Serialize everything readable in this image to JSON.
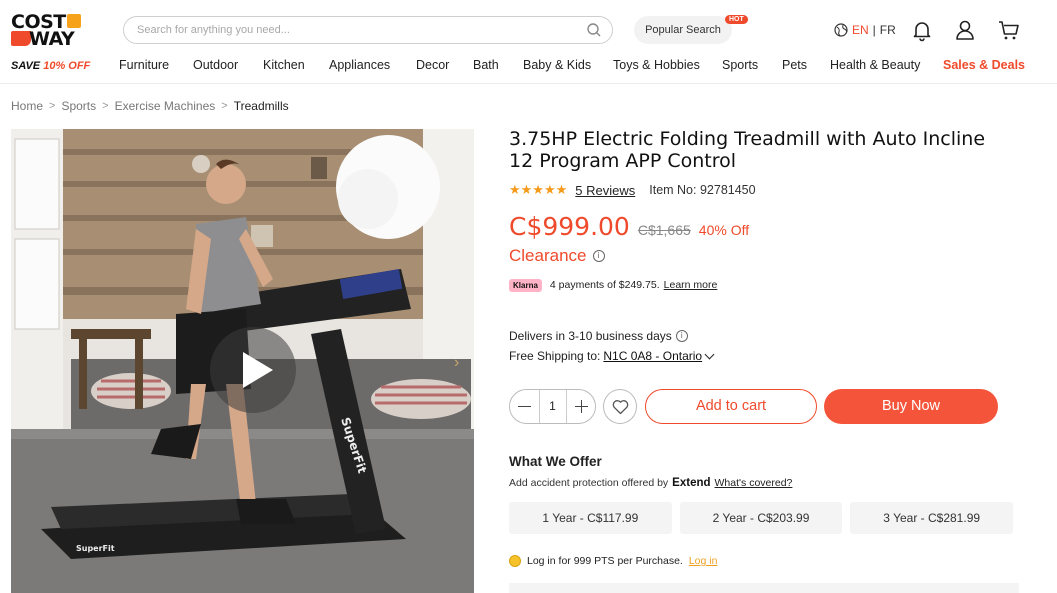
{
  "brand": {
    "logo_line1": "COST",
    "logo_line2": "WAY",
    "save_prefix": "SAVE",
    "save_pct": "10% OFF",
    "accent_color": "#ef4a2b",
    "logo_box_color": "#f7a21b"
  },
  "header": {
    "search_placeholder": "Search for anything you need...",
    "popular_search": "Popular Search",
    "hot_badge": "HOT",
    "lang_en": "EN",
    "lang_sep": "|",
    "lang_fr": "FR",
    "icons": [
      "search-icon",
      "globe-icon",
      "bell-icon",
      "user-icon",
      "cart-icon"
    ]
  },
  "nav": [
    "Furniture",
    "Outdoor",
    "Kitchen",
    "Appliances",
    "Decor",
    "Bath",
    "Baby & Kids",
    "Toys & Hobbies",
    "Sports",
    "Pets",
    "Health & Beauty",
    "Sales & Deals"
  ],
  "breadcrumb": {
    "items": [
      "Home",
      "Sports",
      "Exercise Machines"
    ],
    "current": "Treadmills",
    "separator": ">"
  },
  "product": {
    "title": "3.75HP Electric Folding Treadmill with Auto Incline 12 Program APP Control",
    "stars": "★★★★★",
    "reviews": "5 Reviews",
    "item_no": "Item No: 92781450",
    "price": "C$999.00",
    "old_price": "C$1,665",
    "discount": "40% Off",
    "clearance": "Clearance",
    "klarna_badge": "Klarna",
    "klarna_text": "4 payments of $249.75.",
    "klarna_learn": "Learn more",
    "delivers": "Delivers in 3-10 business days",
    "shipping_label": "Free Shipping to:",
    "shipping_location": "N1C 0A8 - Ontario",
    "quantity": "1",
    "add_to_cart": "Add to cart",
    "buy_now": "Buy Now",
    "image_brand_text": "SuperFit"
  },
  "offer": {
    "title": "What We Offer",
    "subtitle": "Add accident protection offered by",
    "provider": "Extend",
    "covered_link": "What's covered?",
    "plans": [
      "1 Year - C$117.99",
      "2 Year - C$203.99",
      "3 Year - C$281.99"
    ]
  },
  "points": {
    "text": "Log in for 999 PTS per Purchase.",
    "login": "Log in"
  }
}
